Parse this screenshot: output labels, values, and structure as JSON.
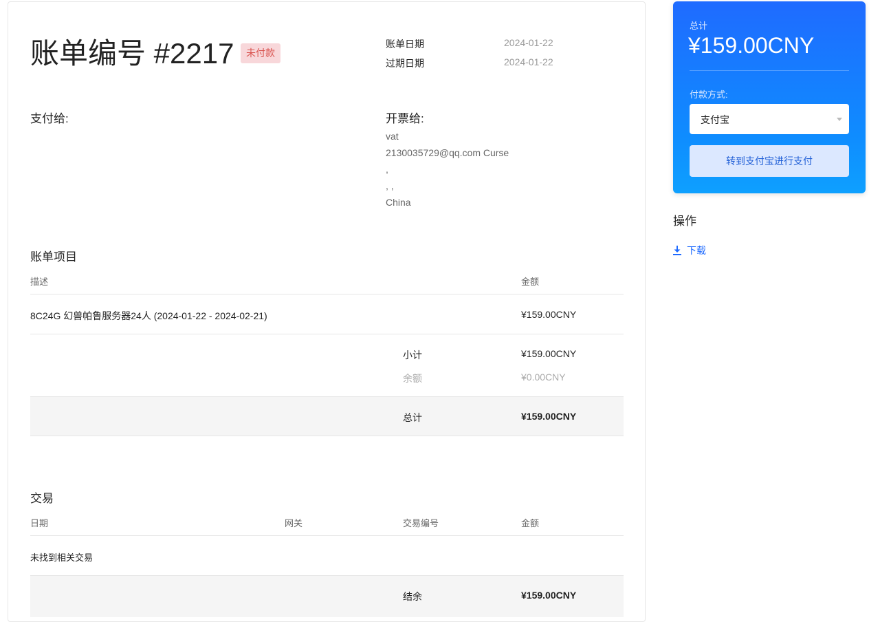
{
  "invoice": {
    "title": "账单编号 #2217",
    "status": "未付款",
    "dates": {
      "invoice_date_label": "账单日期",
      "invoice_date": "2024-01-22",
      "due_date_label": "过期日期",
      "due_date": "2024-01-22"
    },
    "pay_to": {
      "label": "支付给:"
    },
    "invoiced_to": {
      "label": "开票给:",
      "lines": [
        "vat",
        "2130035729@qq.com Curse",
        ",",
        ", ,",
        "China"
      ]
    },
    "items": {
      "title": "账单项目",
      "col_description": "描述",
      "col_amount": "金额",
      "rows": [
        {
          "description": "8C24G 幻兽帕鲁服务器24人 (2024-01-22 - 2024-02-21)",
          "amount": "¥159.00CNY"
        }
      ],
      "subtotal_label": "小计",
      "subtotal": "¥159.00CNY",
      "balance_label": "余额",
      "balance": "¥0.00CNY",
      "total_label": "总计",
      "total": "¥159.00CNY"
    },
    "transactions": {
      "title": "交易",
      "col_date": "日期",
      "col_gateway": "网关",
      "col_txn_id": "交易编号",
      "col_amount": "金额",
      "empty_text": "未找到相关交易",
      "balance_label": "结余",
      "balance": "¥159.00CNY"
    }
  },
  "payment_card": {
    "total_label": "总计",
    "total_amount": "¥159.00CNY",
    "method_label": "付款方式:",
    "method_selected": "支付宝",
    "pay_button": "转到支付宝进行支付"
  },
  "actions": {
    "title": "操作",
    "download": "下载",
    "download_icon": "download-icon"
  },
  "colors": {
    "accent": "#1f6bff",
    "badge_bg": "#f8d7da",
    "badge_text": "#d9534f"
  }
}
